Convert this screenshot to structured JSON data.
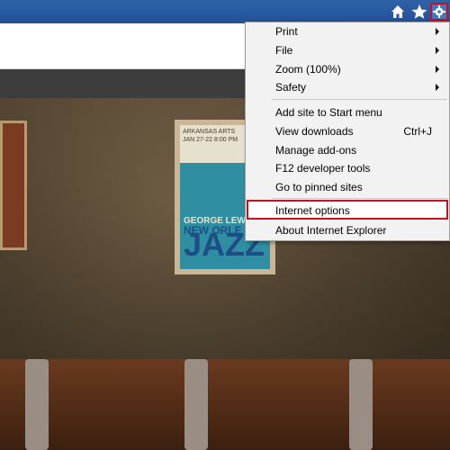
{
  "toolbar": {
    "icons": [
      "home-icon",
      "favorites-star-icon",
      "tools-gear-icon"
    ]
  },
  "menu": {
    "items": [
      {
        "label": "Print",
        "has_submenu": true
      },
      {
        "label": "File",
        "has_submenu": true
      },
      {
        "label": "Zoom (100%)",
        "has_submenu": true
      },
      {
        "label": "Safety",
        "has_submenu": true
      },
      {
        "label": "Add site to Start menu"
      },
      {
        "label": "View downloads",
        "shortcut": "Ctrl+J"
      },
      {
        "label": "Manage add-ons"
      },
      {
        "label": "F12 developer tools"
      },
      {
        "label": "Go to pinned sites"
      },
      {
        "label": "Internet options",
        "highlighted": true
      },
      {
        "label": "About Internet Explorer"
      }
    ]
  },
  "poster": {
    "line1": "ARKANSAS ARTS",
    "line2": "JAN 27-22 8:00 PM",
    "artist": "GEORGE LEWIS",
    "subtitle": "NEW ORLE",
    "title": "JAZZ"
  },
  "colors": {
    "titlebar": "#2757a0",
    "highlight_border": "#c8101e",
    "menu_bg": "#f2f2f2"
  }
}
